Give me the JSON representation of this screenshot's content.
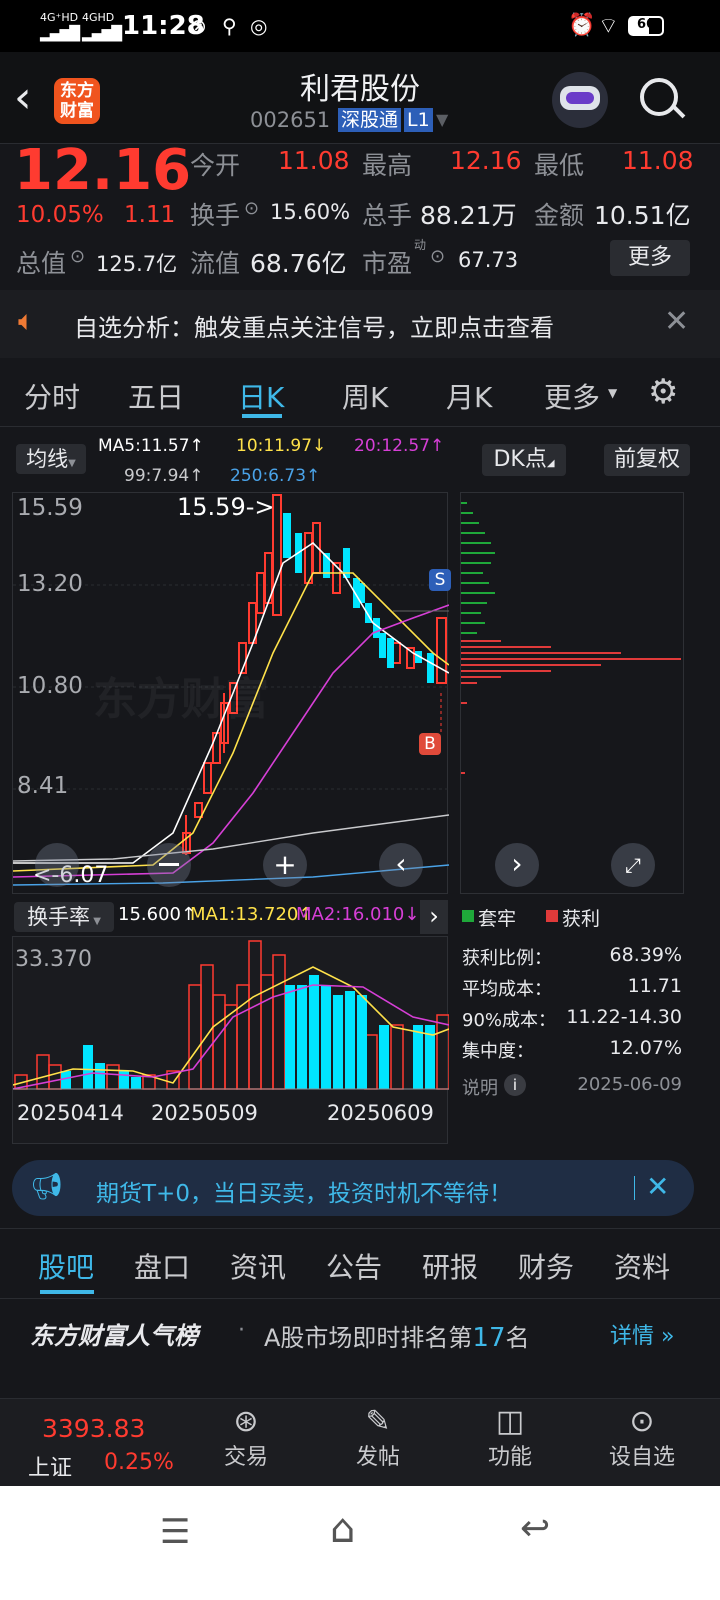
{
  "status_bar": {
    "net1": "4G⁺HD",
    "net2": "4GHD",
    "time": "11:28",
    "battery": "66"
  },
  "header": {
    "title": "利君股份",
    "code": "002651",
    "tag": "深股通",
    "level": "L1",
    "logo_text": "东方财富"
  },
  "quote": {
    "price": "12.16",
    "change_pct": "10.05%",
    "change": "1.11",
    "open_label": "今开",
    "open": "11.08",
    "high_label": "最高",
    "high": "12.16",
    "low_label": "最低",
    "low": "11.08",
    "turnover_label": "换手",
    "turnover": "15.60%",
    "volume_label": "总手",
    "volume": "88.21万",
    "amount_label": "金额",
    "amount": "10.51亿",
    "mcap_label": "总值",
    "mcap": "125.7亿",
    "float_label": "流值",
    "float": "68.76亿",
    "pe_label": "市盈",
    "pe_sup": "动",
    "pe": "67.73",
    "more": "更多"
  },
  "notice": {
    "text": "自选分析：触发重点关注信号，立即点击查看"
  },
  "chart_tabs": [
    "分时",
    "五日",
    "日K",
    "周K",
    "月K",
    "更多"
  ],
  "chart_tabs_active": 2,
  "indicators": {
    "ma_button": "均线",
    "ma5": "MA5:11.57↑",
    "ma10": "10:11.97↓",
    "ma20": "20:12.57↑",
    "ma99": "99:7.94↑",
    "ma250": "250:6.73↑",
    "dk_button": "DK点",
    "adj_button": "前复权"
  },
  "kline": {
    "y_labels": [
      "15.59",
      "13.20",
      "10.80",
      "8.41"
    ],
    "high_marker": "15.59->",
    "low_marker": "<-6.07",
    "watermark": "东方财富",
    "sell_marker": "S",
    "buy_marker": "B"
  },
  "turnover_panel": {
    "button": "换手率",
    "value": "15.600↑",
    "ma1": "MA1:13.720↑",
    "ma2": "MA2:16.010↓",
    "max_label": "33.370",
    "dates": [
      "20250414",
      "20250509",
      "20250609"
    ]
  },
  "chip": {
    "legend_trapped": "套牢",
    "legend_profit": "获利",
    "rows": [
      {
        "label": "获利比例：",
        "value": "68.39%"
      },
      {
        "label": "平均成本：",
        "value": "11.71"
      },
      {
        "label": "90%成本：",
        "value": "11.22-14.30"
      },
      {
        "label": "集中度：",
        "value": "12.07%"
      }
    ],
    "note": "说明",
    "date": "2025-06-09"
  },
  "ad": {
    "text": "期货T+0，当日买卖，投资时机不等待！"
  },
  "section_tabs": [
    "股吧",
    "盘口",
    "资讯",
    "公告",
    "研报",
    "财务",
    "资料"
  ],
  "popularity": {
    "brand": "东方财富人气榜",
    "text": "A股市场即时排名第",
    "rank": "17",
    "suffix": "名",
    "detail": "详情"
  },
  "bottom_nav": {
    "index_value": "3393.83",
    "index_name": "上证",
    "index_change": "0.25%",
    "items": [
      "交易",
      "发帖",
      "功能",
      "设自选"
    ]
  },
  "colors": {
    "up": "#ff3b30",
    "down": "#00e5ff",
    "accent": "#3fb8e8",
    "ma5": "#ffffff",
    "ma10": "#ffe24a",
    "ma20": "#d63fd6"
  }
}
